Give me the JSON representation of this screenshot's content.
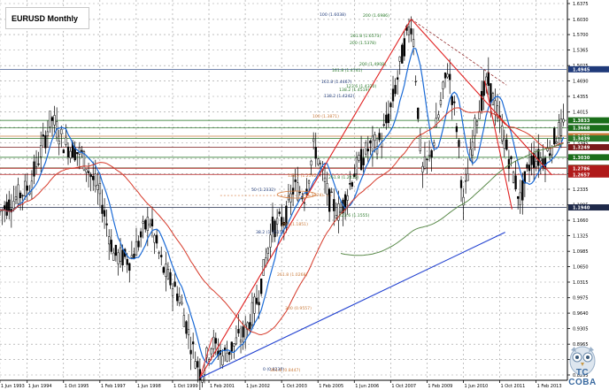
{
  "chart_data": {
    "type": "candlestick",
    "title": "EURUSD Monthly",
    "x_tick_labels": [
      "1 Jun 1993",
      "1 Jun 1994",
      "1 Oct 1995",
      "1 Feb 1997",
      "1 Jun 1998",
      "1 Oct 1999",
      "1 Feb 2001",
      "1 Jun 2002",
      "1 Oct 2003",
      "1 Feb 2005",
      "1 Jun 2006",
      "1 Oct 2007",
      "1 Feb 2009",
      "1 Jun 2010",
      "1 Oct 2011",
      "1 Feb 2013"
    ],
    "y_tick_labels": [
      "1.6375",
      "1.6030",
      "1.5700",
      "1.5365",
      "1.5025",
      "1.4690",
      "1.4355",
      "1.4015",
      "1.3680",
      "1.3345",
      "1.3005",
      "1.2670",
      "1.2335",
      "1.1995",
      "1.1660",
      "1.1325",
      "1.0985",
      "1.0650",
      "1.0315",
      "0.9975",
      "0.9640",
      "0.9305",
      "0.8965",
      "0.8630",
      "0.8295"
    ],
    "ylim": [
      0.8295,
      1.6375
    ],
    "price_tags": [
      {
        "value": "1.4945",
        "color": "#1f3a7a"
      },
      {
        "value": "1.3833",
        "color": "#1a6e1a"
      },
      {
        "value": "1.3668",
        "color": "#1a6e1a"
      },
      {
        "value": "1.3489",
        "color": "#c97a3a"
      },
      {
        "value": "1.3439",
        "color": "#2a7a2a"
      },
      {
        "value": "1.3249",
        "color": "#7a1a1a"
      },
      {
        "value": "1.3030",
        "color": "#1a6e1a"
      },
      {
        "value": "1.2800",
        "color": "#6b3b1a"
      },
      {
        "value": "1.2786",
        "color": "#b01a1a"
      },
      {
        "value": "1.2657",
        "color": "#b01a1a"
      },
      {
        "value": "1.1940",
        "color": "#1f2a4a"
      }
    ],
    "fib_labels": [
      {
        "text": "100 (1.6038)",
        "color": "#1f3a7a"
      },
      {
        "text": "200 (1.6986)",
        "color": "#2a7a2a"
      },
      {
        "text": "261.8 (1.6573)",
        "color": "#2a7a2a"
      },
      {
        "text": "200 (1.5378)",
        "color": "#2a7a2a"
      },
      {
        "text": "200 (1.4908)",
        "color": "#2a7a2a"
      },
      {
        "text": "161.8 (1.4741)",
        "color": "#2a7a2a"
      },
      {
        "text": "138.2 (1.4519)",
        "color": "#2a7a2a"
      },
      {
        "text": "161.8 (1.4467)",
        "color": "#1f3a7a"
      },
      {
        "text": "123.6 (1.4320)",
        "color": "#2a7a2a"
      },
      {
        "text": "138.2 (1.4242)",
        "color": "#1f3a7a"
      },
      {
        "text": "100 (1.3871)",
        "color": "#c97a3a"
      },
      {
        "text": "50 (1.2332)",
        "color": "#1f3a7a"
      },
      {
        "text": "138.2 (1.2592)",
        "color": "#c97a3a"
      },
      {
        "text": "261.8 (1.2412)",
        "color": "#2a7a2a"
      },
      {
        "text": "0 (1.1974)",
        "color": "#c97a3a"
      },
      {
        "text": "423.6 (1.1555)",
        "color": "#2a7a2a"
      },
      {
        "text": "200 (1.1851)",
        "color": "#c97a3a"
      },
      {
        "text": "38.2 (1.1515)",
        "color": "#1f3a7a"
      },
      {
        "text": "261.8 (1.0268)",
        "color": "#c97a3a"
      },
      {
        "text": "300 (0.9557)",
        "color": "#c97a3a"
      },
      {
        "text": "0 (0.8230)",
        "color": "#1f3a7a"
      },
      {
        "text": "361.8 (0.8447)",
        "color": "#c97a3a"
      }
    ],
    "swing_points": [
      {
        "date": "1 Oct 2000",
        "price": 0.823
      },
      {
        "date": "1 Jul 2008",
        "price": 1.6038
      },
      {
        "date": "1 Jun 2010",
        "price": 1.1876
      },
      {
        "date": "1 Jul 2012",
        "price": 1.2042
      }
    ],
    "moving_averages": [
      {
        "color": "#1a6ad6"
      },
      {
        "color": "#d63a2a"
      },
      {
        "color": "#5a8a4a"
      }
    ],
    "grid": true
  },
  "logo": {
    "text": "TC COBA",
    "color": "#3a6aa0"
  }
}
